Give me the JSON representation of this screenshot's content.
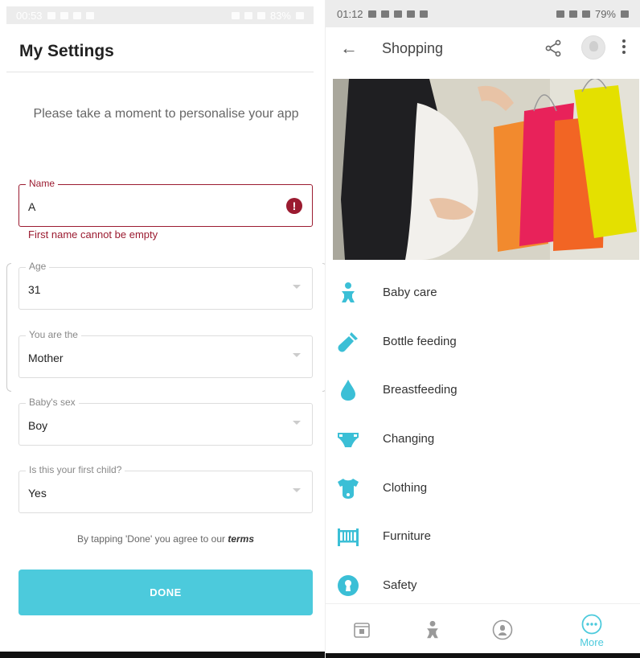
{
  "left_screen": {
    "status_bar": {
      "time": "00:53",
      "battery": "83%"
    },
    "title": "My Settings",
    "intro": "Please take a moment to personalise your app",
    "fields": {
      "name": {
        "label": "Name",
        "value": "A",
        "error": "First name cannot be empty"
      },
      "age": {
        "label": "Age",
        "value": "31"
      },
      "role": {
        "label": "You are the",
        "value": "Mother"
      },
      "baby_sex": {
        "label": "Baby's sex",
        "value": "Boy"
      },
      "first_child": {
        "label": "Is this your first child?",
        "value": "Yes"
      }
    },
    "terms": {
      "prefix": "By tapping 'Done' you agree to our",
      "link": "terms"
    },
    "done_label": "DONE"
  },
  "right_screen": {
    "status_bar": {
      "time": "01:12",
      "battery": "79%"
    },
    "title": "Shopping",
    "categories": [
      {
        "label": "Baby care",
        "icon": "baby-icon"
      },
      {
        "label": "Bottle feeding",
        "icon": "bottle-icon"
      },
      {
        "label": "Breastfeeding",
        "icon": "drop-icon"
      },
      {
        "label": "Changing",
        "icon": "diaper-icon"
      },
      {
        "label": "Clothing",
        "icon": "onesie-icon"
      },
      {
        "label": "Furniture",
        "icon": "crib-icon"
      },
      {
        "label": "Safety",
        "icon": "keyhole-icon"
      }
    ],
    "bottom_nav": {
      "more_label": "More"
    }
  },
  "colors": {
    "accent": "#4ccadc",
    "error": "#9b1b30",
    "icon": "#3bbfd6"
  }
}
